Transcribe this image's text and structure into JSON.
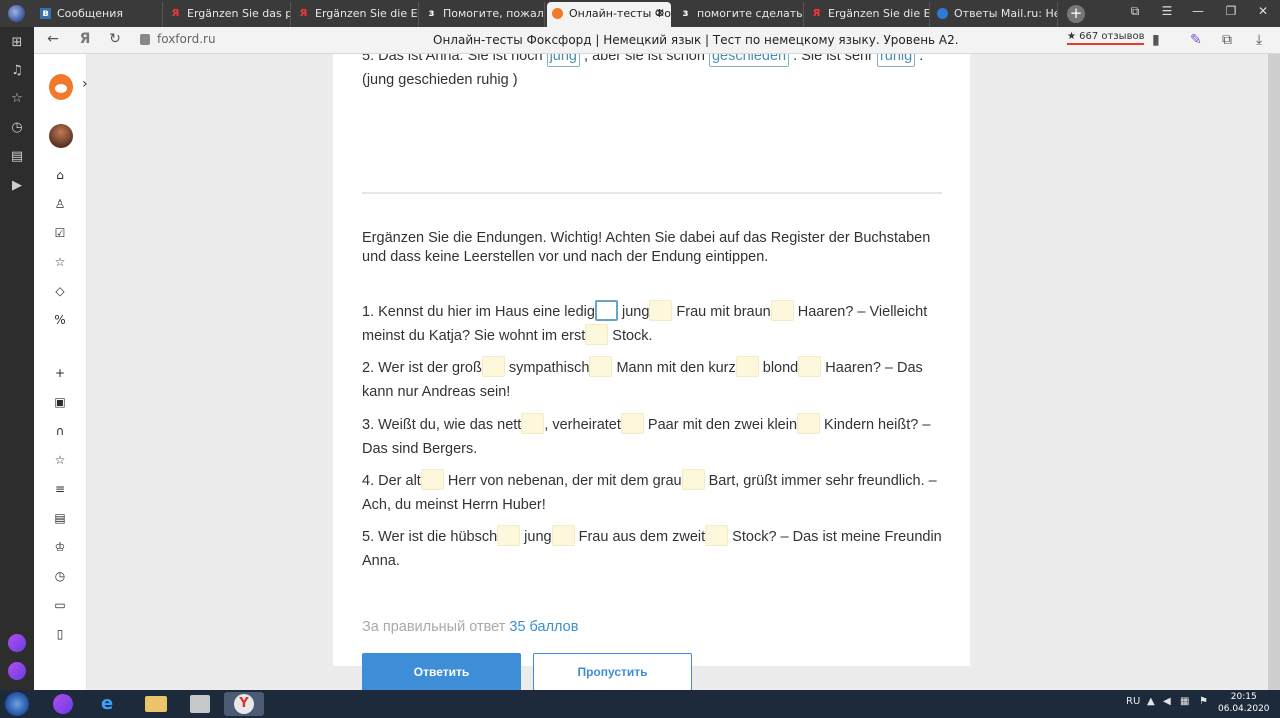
{
  "browser": {
    "tabs": [
      {
        "label": "Сообщения",
        "favicon": "vk-icon",
        "active": false
      },
      {
        "label": "Ergänzen Sie das passe",
        "favicon": "yandex-icon",
        "active": false
      },
      {
        "label": "Ergänzen Sie die Endun",
        "favicon": "yandex-icon",
        "active": false
      },
      {
        "label": "Помогите, пожалуйст",
        "favicon": "znanija-icon",
        "active": false
      },
      {
        "label": "Онлайн-тесты Фокс",
        "favicon": "foxford-icon",
        "active": true
      },
      {
        "label": "помогите сделать зад",
        "favicon": "znanija-icon",
        "active": false
      },
      {
        "label": "Ergänzen Sie die Endun",
        "favicon": "yandex-icon",
        "active": false
      },
      {
        "label": "Ответы Mail.ru: Неме",
        "favicon": "mail-icon",
        "active": false
      }
    ],
    "domain": "foxford.ru",
    "page_title": "Онлайн-тесты Фоксфорд | Немецкий язык | Тест по немецкому языку. Уровень А2.",
    "reviews": "★ 667 отзывов"
  },
  "quiz": {
    "previous_question": {
      "parts": [
        "5. Das ist Anna. Sie ist noch ",
        " , aber sie ist schon ",
        " . Sie ist sehr ",
        " . (jung geschieden ruhig )"
      ],
      "answers": [
        "jung",
        "geschieden",
        "ruhig"
      ]
    },
    "instruction": "Ergänzen Sie die Endungen. Wichtig! Achten Sie dabei auf das Register der Buchstaben und dass keine Leerstellen vor und nach der Endung eintippen.",
    "items": [
      {
        "parts": [
          "1. Kennst du hier im Haus eine ledig",
          " jung",
          " Frau mit braun",
          " Haaren? – Vielleicht meinst du Katja? Sie wohnt im erst",
          " Stock."
        ]
      },
      {
        "parts": [
          "2. Wer ist der groß",
          " sympathisch",
          " Mann mit den kurz",
          " blond",
          " Haaren? – Das kann nur Andreas sein!"
        ]
      },
      {
        "parts": [
          "3. Weißt du, wie das nett",
          ", verheiratet",
          " Paar mit den zwei klein",
          " Kindern heißt? – Das sind Bergers."
        ]
      },
      {
        "parts": [
          "4. Der alt",
          " Herr von nebenan, der mit dem grau",
          " Bart, grüßt immer sehr freundlich. – Ach, du meinst Herrn Huber!"
        ]
      },
      {
        "parts": [
          "5. Wer ist die hübsch",
          " jung",
          " Frau aus dem zweit",
          " Stock? – Das ist meine Freundin Anna."
        ]
      }
    ],
    "score_prefix": "За правильный ответ",
    "score_points": "35 баллов",
    "submit_label": "Ответить",
    "skip_label": "Пропустить"
  },
  "taskbar": {
    "lang": "RU",
    "time": "20:15",
    "date": "06.04.2020"
  }
}
